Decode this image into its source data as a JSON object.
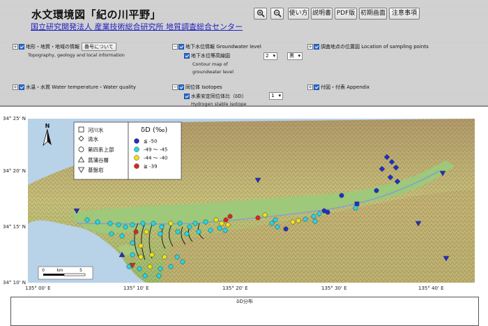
{
  "header": {
    "title": "水文環境図「紀の川平野」",
    "org": "国立研究開発法人 産業技術総合研究所 地質調査総合センター"
  },
  "toolbar": {
    "zoom_in": "zoom-in",
    "zoom_out": "zoom-out",
    "usage": "使い方",
    "manual": "説明書",
    "pdf": "PDF版",
    "initial": "初期画面",
    "notes": "注意事項"
  },
  "sections": {
    "topo": {
      "label": "地形・地質・地域の情報",
      "button": "番号について",
      "sub": "Topography, geology and local information"
    },
    "gw": {
      "label": "地下水位情報 Groundwater level",
      "item": "地下水位等高線図",
      "item_sub1": "Contour map of",
      "item_sub2": "groundwater level",
      "select1": "2",
      "select2": "黒"
    },
    "sampling": {
      "label": "調査地点の位置図 Location of sampling points"
    },
    "temp": {
      "label": "水温・水質 Water temperature・Water quality"
    },
    "iso": {
      "label": "同位体 Isotopes",
      "item": "水素安定同位体比（δD）",
      "item_sub": "Hydrogen stable isotope",
      "select1": "1"
    },
    "appendix": {
      "label": "付図・付表 Appendix"
    }
  },
  "map": {
    "lat_labels": [
      "34° 25' N",
      "34° 20' N",
      "34° 15' N",
      "34° 10' N"
    ],
    "lon_labels": [
      "135° 00' E",
      "135° 10' E",
      "135° 20' E",
      "135° 30' E",
      "135° 40' E"
    ],
    "north": "N",
    "scale": {
      "zero": "0",
      "unit": "km",
      "five": "5"
    },
    "legend_types": [
      {
        "symbol": "square",
        "label": "河川水"
      },
      {
        "symbol": "diamond",
        "label": "清水"
      },
      {
        "symbol": "circle",
        "label": "第四系上部"
      },
      {
        "symbol": "triangle-up",
        "label": "菖蒲谷層"
      },
      {
        "symbol": "triangle-down",
        "label": "基盤岩"
      }
    ],
    "legend_values_title": "δD (‰)",
    "legend_values": [
      {
        "label": "≦ -50",
        "color": "#1f2fc8"
      },
      {
        "label": "-49 ～ -45",
        "color": "#22d8e8"
      },
      {
        "label": "-44 ～ -40",
        "color": "#f2e21a"
      },
      {
        "label": "≧ -39",
        "color": "#e0261a"
      }
    ]
  },
  "footer": {
    "label": "δD分布"
  }
}
